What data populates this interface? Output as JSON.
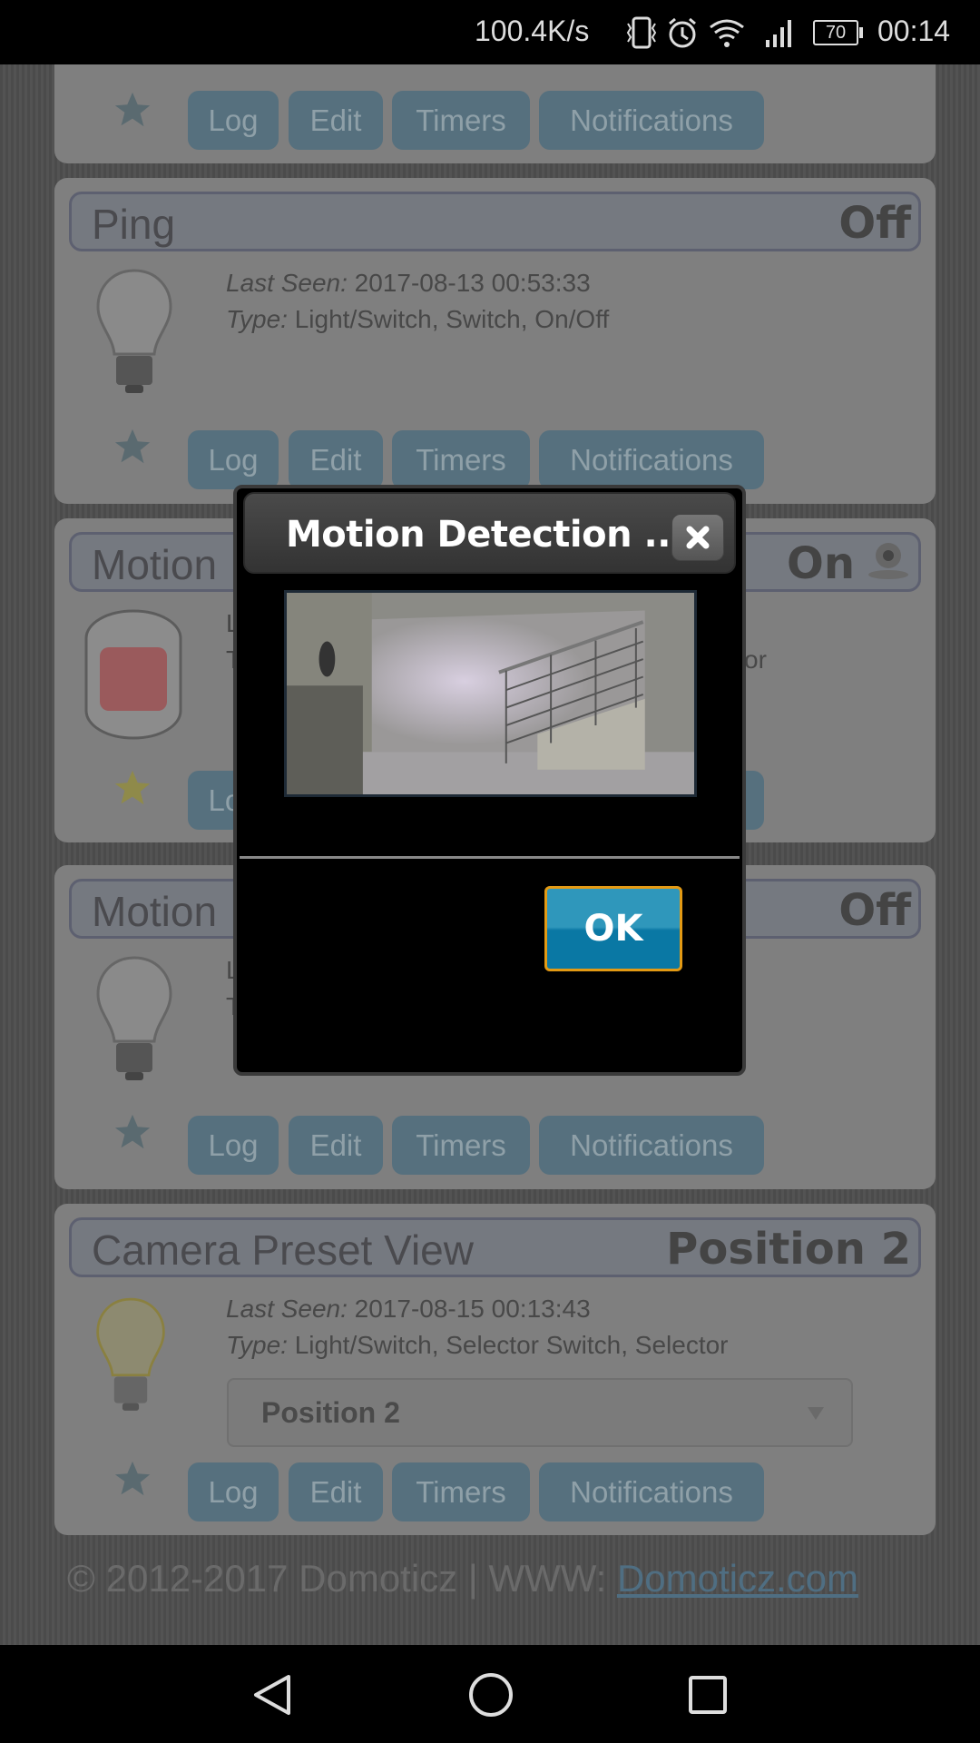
{
  "status_bar": {
    "net_speed": "100.4K/s",
    "battery": "70",
    "time": "00:14",
    "icons": [
      "vibrate-icon",
      "alarm-icon",
      "wifi-icon",
      "signal-icon",
      "battery-icon"
    ]
  },
  "buttons": {
    "log": "Log",
    "edit": "Edit",
    "timers": "Timers",
    "notifications": "Notifications"
  },
  "devices": [
    {
      "name": "Ping",
      "status": "Off",
      "last_seen_label": "Last Seen:",
      "last_seen": "2017-08-13 00:53:33",
      "type_label": "Type:",
      "type": "Light/Switch, Switch, On/Off",
      "icon": "bulb-off-icon",
      "favorite": false
    },
    {
      "name": "Motion",
      "status": "On",
      "line1_fragment": "L",
      "line2_fragment": "T",
      "type_fragment": "or",
      "icon": "motion-sensor-icon",
      "status_icon": "webcam-icon",
      "favorite": true
    },
    {
      "name": "Motion",
      "status": "Off",
      "line1_fragment": "L",
      "line2_fragment": "T",
      "icon": "bulb-off-icon",
      "favorite": false
    },
    {
      "name": "Camera Preset View",
      "status": "Position 2",
      "last_seen_label": "Last Seen:",
      "last_seen": "2017-08-15 00:13:43",
      "type_label": "Type:",
      "type": "Light/Switch, Selector Switch, Selector",
      "selector_value": "Position 2",
      "icon": "bulb-on-icon",
      "favorite": false
    }
  ],
  "footer": {
    "copyright": "© 2012-2017 Domoticz | WWW: ",
    "link": "Domoticz.com"
  },
  "dialog": {
    "title": "Motion Detection ...",
    "ok_label": "OK"
  },
  "colors": {
    "ok_button": "#0a78a4",
    "ok_focus_border": "#e39a14",
    "action_button": "#56707e"
  }
}
